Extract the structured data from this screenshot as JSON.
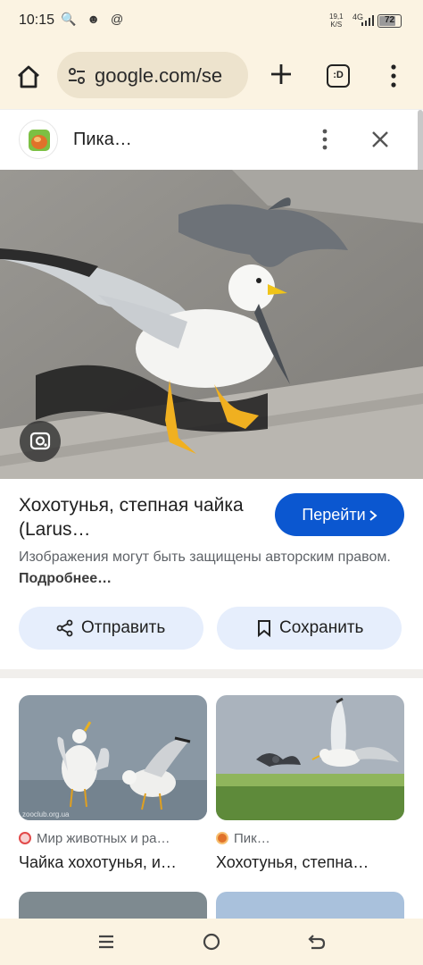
{
  "status_bar": {
    "time": "10:15",
    "left_icons": "🔍 ☻ @",
    "net_speed_top": "19,1",
    "net_speed_bottom": "K/S",
    "network": "4G",
    "battery": "72"
  },
  "toolbar": {
    "url": "google.com/se",
    "tab_count": ":D"
  },
  "sheet": {
    "site_name": "Пика…",
    "result_title": "Хохотунья, степная чайка (Larus…",
    "visit_label": "Перейти",
    "copyright_text": "Изображения могут быть защищены авторским правом.",
    "copyright_more": "Подробнее…",
    "share_label": "Отправить",
    "save_label": "Сохранить"
  },
  "related": [
    {
      "source": "Мир животных и ра…",
      "title": "Чайка хохотунья, и…",
      "watermark": "zooclub.org.ua"
    },
    {
      "source": "Пик…",
      "title": "Хохотунья, степна…"
    }
  ],
  "colors": {
    "accent": "#0b57d0",
    "pill_bg": "#e6eefc",
    "chrome_bg": "#fbf3e2"
  }
}
